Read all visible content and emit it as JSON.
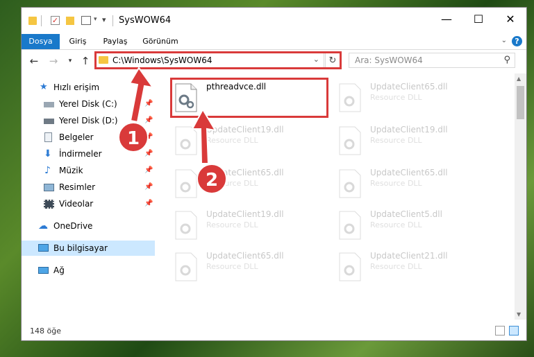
{
  "window": {
    "title": "SysWOW64",
    "minimize": "—",
    "maximize": "☐",
    "close": "✕"
  },
  "ribbon": {
    "tabs": [
      "Dosya",
      "Giriş",
      "Paylaş",
      "Görünüm"
    ],
    "help": "?",
    "accent": "#1979ca"
  },
  "nav": {
    "address": "C:\\Windows\\SysWOW64",
    "search_placeholder": "Ara: SysWOW64"
  },
  "sidebar": {
    "items": [
      {
        "label": "Hızlı erişim",
        "icon": "star-icon"
      },
      {
        "label": "Yerel Disk (C:)",
        "icon": "drive-c-icon"
      },
      {
        "label": "Yerel Disk (D:)",
        "icon": "drive-icon"
      },
      {
        "label": "Belgeler",
        "icon": "documents-icon"
      },
      {
        "label": "İndirmeler",
        "icon": "download-icon"
      },
      {
        "label": "Müzik",
        "icon": "music-icon"
      },
      {
        "label": "Resimler",
        "icon": "pictures-icon"
      },
      {
        "label": "Videolar",
        "icon": "videos-icon"
      },
      {
        "label": "OneDrive",
        "icon": "cloud-icon"
      },
      {
        "label": "Bu bilgisayar",
        "icon": "computer-icon"
      },
      {
        "label": "Ağ",
        "icon": "network-icon"
      }
    ]
  },
  "files": [
    {
      "name": "pthreadvce.dll",
      "type": ""
    },
    {
      "name": "UpdateClient65.dll",
      "type": "Resource DLL"
    },
    {
      "name": "UpdateClient19.dll",
      "type": "Resource DLL"
    },
    {
      "name": "UpdateClient19.dll",
      "type": "Resource DLL"
    },
    {
      "name": "UpdateClient65.dll",
      "type": "Resource DLL"
    },
    {
      "name": "UpdateClient65.dll",
      "type": "Resource DLL"
    },
    {
      "name": "UpdateClient19.dll",
      "type": "Resource DLL"
    },
    {
      "name": "UpdateClient5.dll",
      "type": "Resource DLL"
    },
    {
      "name": "UpdateClient65.dll",
      "type": "Resource DLL"
    },
    {
      "name": "UpdateClient21.dll",
      "type": "Resource DLL"
    }
  ],
  "status": {
    "count": "148 öğe"
  },
  "annotations": {
    "step1": "1",
    "step2": "2",
    "color": "#d93a3a"
  }
}
